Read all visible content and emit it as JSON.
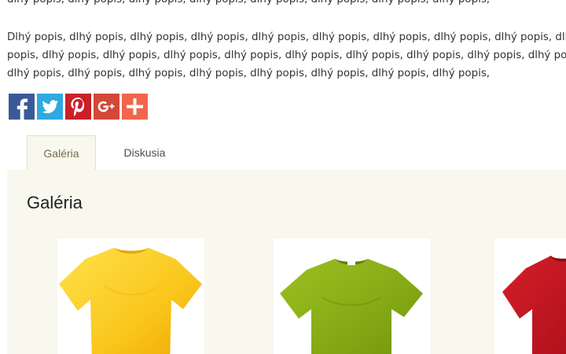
{
  "description": {
    "top_line": "dlhý popis, dlhý popis, dlhý popis, dlhý popis, dlhý popis, dlhý popis, dlhý popis, dlhý popis,",
    "lines": [
      "Dlhý popis, dlhý popis, dlhý popis, dlhý popis, dlhý popis, dlhý popis, dlhý popis, dlhý popis, dlhý popis, dlhý popis",
      "popis, dlhý popis, dlhý popis, dlhý popis, dlhý popis,  dlhý popis, dlhý popis, dlhý popis, dlhý popis, dlhý popis",
      "dlhý popis, dlhý popis,  dlhý popis, dlhý popis, dlhý popis, dlhý popis, dlhý popis, dlhý popis,"
    ]
  },
  "share": {
    "buttons": [
      {
        "icon": "facebook-icon",
        "color": "#3b5998"
      },
      {
        "icon": "twitter-icon",
        "color": "#2fa9e0"
      },
      {
        "icon": "pinterest-icon",
        "color": "#cb2027"
      },
      {
        "icon": "google-plus-icon",
        "color": "#d34836",
        "label": "G+"
      },
      {
        "icon": "plus-icon",
        "color": "#f1654c"
      }
    ]
  },
  "tabs": [
    {
      "label": "Galéria",
      "active": true
    },
    {
      "label": "Diskusia",
      "active": false
    }
  ],
  "gallery": {
    "title": "Galéria",
    "items": [
      {
        "name": "yellow t-shirt",
        "color": "#f7c21a"
      },
      {
        "name": "green t-shirt",
        "color": "#86aa16"
      },
      {
        "name": "red t-shirt",
        "color": "#c0141f"
      }
    ]
  },
  "colors": {
    "panel_background": "#f8f8ef",
    "border": "#e3dfc6",
    "active_tab_text": "#7a6a4c"
  }
}
